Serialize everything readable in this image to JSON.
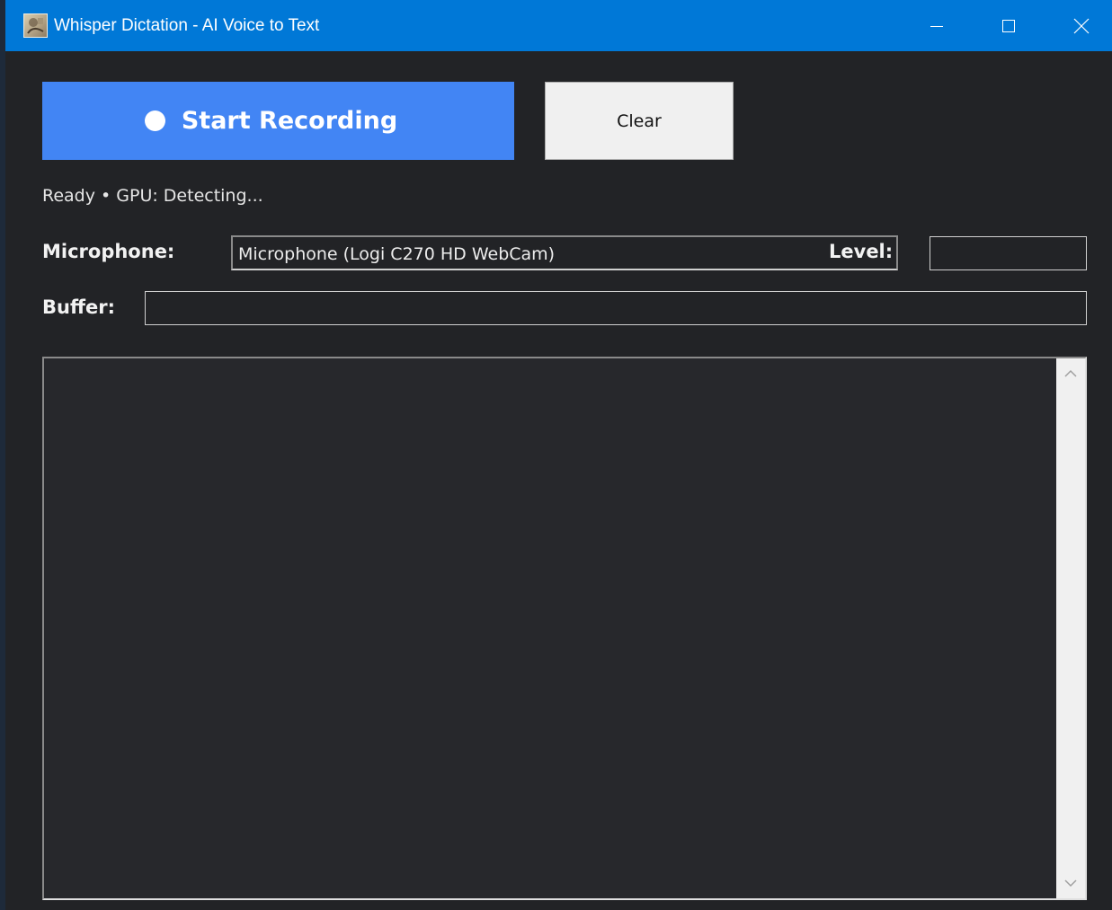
{
  "window": {
    "title": "Whisper Dictation - AI Voice to Text",
    "icon": "app-icon"
  },
  "toolbar": {
    "start_label": "Start Recording",
    "clear_label": "Clear"
  },
  "status": {
    "text": "Ready • GPU: Detecting..."
  },
  "microphone": {
    "label": "Microphone:",
    "selected": "Microphone (Logi C270 HD WebCam)"
  },
  "level": {
    "label": "Level:",
    "value": 0
  },
  "buffer": {
    "label": "Buffer:",
    "value": 0
  },
  "transcript": {
    "text": ""
  },
  "colors": {
    "titlebar": "#0078d7",
    "accent": "#4285f4",
    "background": "#222326"
  }
}
